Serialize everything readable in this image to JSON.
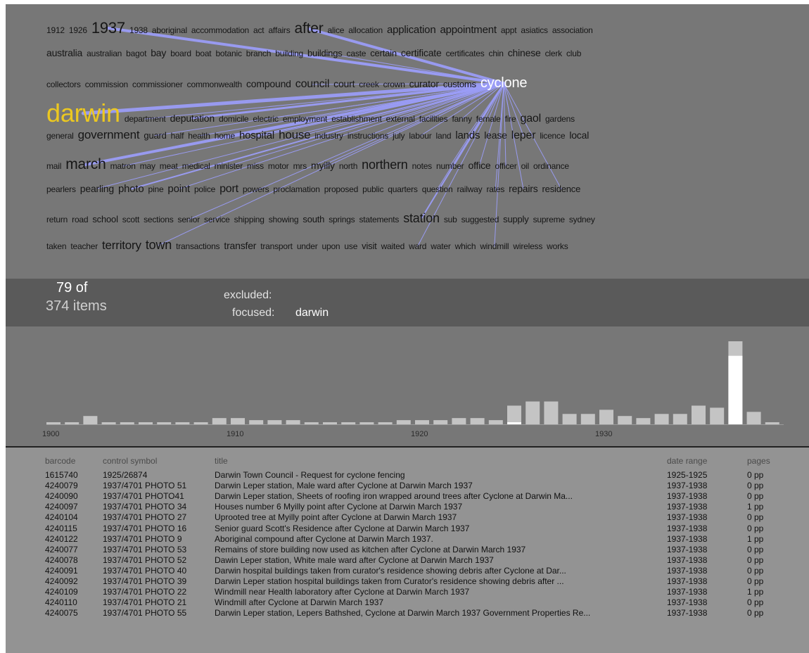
{
  "cloud": {
    "highlight_word": "darwin",
    "focus_word": "cyclone",
    "line_color": "#9a9cf6",
    "highlight_color": "#ecc820",
    "rows": [
      [
        {
          "t": "1912",
          "s": 12
        },
        {
          "t": "1926",
          "s": 12
        },
        {
          "t": "1937",
          "s": 22
        },
        {
          "t": "1938",
          "s": 12
        },
        {
          "t": "aboriginal",
          "s": 12
        },
        {
          "t": "accommodation",
          "s": 12
        },
        {
          "t": "act",
          "s": 12
        },
        {
          "t": "affairs",
          "s": 12
        },
        {
          "t": "after",
          "s": 21
        },
        {
          "t": "alice",
          "s": 12
        },
        {
          "t": "allocation",
          "s": 12
        },
        {
          "t": "application",
          "s": 15
        },
        {
          "t": "appointment",
          "s": 15
        },
        {
          "t": "appt",
          "s": 12
        },
        {
          "t": "asiatics",
          "s": 12
        },
        {
          "t": "association",
          "s": 12
        }
      ],
      [
        {
          "t": "australia",
          "s": 14
        },
        {
          "t": "australian",
          "s": 12
        },
        {
          "t": "bagot",
          "s": 12
        },
        {
          "t": "bay",
          "s": 14
        },
        {
          "t": "board",
          "s": 12
        },
        {
          "t": "boat",
          "s": 12
        },
        {
          "t": "botanic",
          "s": 12
        },
        {
          "t": "branch",
          "s": 12
        },
        {
          "t": "building",
          "s": 12
        },
        {
          "t": "buildings",
          "s": 13
        },
        {
          "t": "caste",
          "s": 12
        },
        {
          "t": "certain",
          "s": 13
        },
        {
          "t": "certificate",
          "s": 14
        },
        {
          "t": "certificates",
          "s": 12
        },
        {
          "t": "chin",
          "s": 12
        },
        {
          "t": "chinese",
          "s": 14
        },
        {
          "t": "clerk",
          "s": 12
        },
        {
          "t": "club",
          "s": 12
        }
      ],
      [
        {
          "t": "collectors",
          "s": 12
        },
        {
          "t": "commission",
          "s": 12
        },
        {
          "t": "commissioner",
          "s": 12
        },
        {
          "t": "commonwealth",
          "s": 12
        },
        {
          "t": "compound",
          "s": 14
        },
        {
          "t": "council",
          "s": 16
        },
        {
          "t": "court",
          "s": 14
        },
        {
          "t": "creek",
          "s": 12
        },
        {
          "t": "crown",
          "s": 12
        },
        {
          "t": "curator",
          "s": 14
        },
        {
          "t": "customs",
          "s": 13
        },
        {
          "t": "cyclone",
          "s": 20
        }
      ],
      [
        {
          "t": "darwin",
          "s": 36
        },
        {
          "t": "department",
          "s": 12
        },
        {
          "t": "deputation",
          "s": 14
        },
        {
          "t": "domicile",
          "s": 12
        },
        {
          "t": "electric",
          "s": 12
        },
        {
          "t": "employment",
          "s": 12
        },
        {
          "t": "establishment",
          "s": 12
        },
        {
          "t": "external",
          "s": 12
        },
        {
          "t": "facilities",
          "s": 12
        },
        {
          "t": "fanny",
          "s": 12
        },
        {
          "t": "female",
          "s": 12
        },
        {
          "t": "fire",
          "s": 12
        },
        {
          "t": "gaol",
          "s": 16
        },
        {
          "t": "gardens",
          "s": 12
        }
      ],
      [
        {
          "t": "general",
          "s": 12
        },
        {
          "t": "government",
          "s": 17
        },
        {
          "t": "guard",
          "s": 13
        },
        {
          "t": "half",
          "s": 12
        },
        {
          "t": "health",
          "s": 12
        },
        {
          "t": "home",
          "s": 12
        },
        {
          "t": "hospital",
          "s": 15
        },
        {
          "t": "house",
          "s": 17
        },
        {
          "t": "industry",
          "s": 12
        },
        {
          "t": "instructions",
          "s": 12
        },
        {
          "t": "july",
          "s": 12
        },
        {
          "t": "labour",
          "s": 12
        },
        {
          "t": "land",
          "s": 12
        },
        {
          "t": "lands",
          "s": 15
        },
        {
          "t": "lease",
          "s": 14
        },
        {
          "t": "leper",
          "s": 16
        },
        {
          "t": "licence",
          "s": 12
        },
        {
          "t": "local",
          "s": 14
        }
      ],
      [
        {
          "t": "mail",
          "s": 12
        },
        {
          "t": "march",
          "s": 21
        },
        {
          "t": "matron",
          "s": 12
        },
        {
          "t": "may",
          "s": 12
        },
        {
          "t": "meat",
          "s": 12
        },
        {
          "t": "medical",
          "s": 12
        },
        {
          "t": "minister",
          "s": 12
        },
        {
          "t": "miss",
          "s": 12
        },
        {
          "t": "motor",
          "s": 12
        },
        {
          "t": "mrs",
          "s": 12
        },
        {
          "t": "myilly",
          "s": 14
        },
        {
          "t": "north",
          "s": 12
        },
        {
          "t": "northern",
          "s": 18
        },
        {
          "t": "notes",
          "s": 12
        },
        {
          "t": "number",
          "s": 12
        },
        {
          "t": "office",
          "s": 14
        },
        {
          "t": "officer",
          "s": 12
        },
        {
          "t": "oil",
          "s": 12
        },
        {
          "t": "ordinance",
          "s": 12
        }
      ],
      [
        {
          "t": "pearlers",
          "s": 12
        },
        {
          "t": "pearling",
          "s": 14
        },
        {
          "t": "photo",
          "s": 15
        },
        {
          "t": "pine",
          "s": 12
        },
        {
          "t": "point",
          "s": 15
        },
        {
          "t": "police",
          "s": 12
        },
        {
          "t": "port",
          "s": 16
        },
        {
          "t": "powers",
          "s": 12
        },
        {
          "t": "proclamation",
          "s": 12
        },
        {
          "t": "proposed",
          "s": 12
        },
        {
          "t": "public",
          "s": 12
        },
        {
          "t": "quarters",
          "s": 12
        },
        {
          "t": "question",
          "s": 12
        },
        {
          "t": "railway",
          "s": 12
        },
        {
          "t": "rates",
          "s": 12
        },
        {
          "t": "repairs",
          "s": 14
        },
        {
          "t": "residence",
          "s": 13
        }
      ],
      [
        {
          "t": "return",
          "s": 12
        },
        {
          "t": "road",
          "s": 12
        },
        {
          "t": "school",
          "s": 13
        },
        {
          "t": "scott",
          "s": 12
        },
        {
          "t": "sections",
          "s": 12
        },
        {
          "t": "senior",
          "s": 12
        },
        {
          "t": "service",
          "s": 12
        },
        {
          "t": "shipping",
          "s": 12
        },
        {
          "t": "showing",
          "s": 12
        },
        {
          "t": "south",
          "s": 13
        },
        {
          "t": "springs",
          "s": 12
        },
        {
          "t": "statements",
          "s": 12
        },
        {
          "t": "station",
          "s": 18
        },
        {
          "t": "sub",
          "s": 12
        },
        {
          "t": "suggested",
          "s": 12
        },
        {
          "t": "supply",
          "s": 13
        },
        {
          "t": "supreme",
          "s": 12
        },
        {
          "t": "sydney",
          "s": 12
        }
      ],
      [
        {
          "t": "taken",
          "s": 12
        },
        {
          "t": "teacher",
          "s": 12
        },
        {
          "t": "territory",
          "s": 17
        },
        {
          "t": "town",
          "s": 18
        },
        {
          "t": "transactions",
          "s": 12
        },
        {
          "t": "transfer",
          "s": 14
        },
        {
          "t": "transport",
          "s": 12
        },
        {
          "t": "under",
          "s": 12
        },
        {
          "t": "upon",
          "s": 12
        },
        {
          "t": "use",
          "s": 12
        },
        {
          "t": "visit",
          "s": 13
        },
        {
          "t": "waited",
          "s": 12
        },
        {
          "t": "ward",
          "s": 12
        },
        {
          "t": "water",
          "s": 12
        },
        {
          "t": "which",
          "s": 12
        },
        {
          "t": "windmill",
          "s": 12
        },
        {
          "t": "wireless",
          "s": 12
        },
        {
          "t": "works",
          "s": 12
        }
      ]
    ],
    "links": [
      {
        "to": "1937",
        "w": 4
      },
      {
        "to": "after",
        "w": 4
      },
      {
        "to": "building",
        "w": 1
      },
      {
        "to": "buildings",
        "w": 1
      },
      {
        "to": "council",
        "w": 1
      },
      {
        "to": "darwin",
        "w": 5
      },
      {
        "to": "department",
        "w": 1
      },
      {
        "to": "deputation",
        "w": 3
      },
      {
        "to": "electric",
        "w": 1
      },
      {
        "to": "employment",
        "w": 1
      },
      {
        "to": "establishment",
        "w": 1
      },
      {
        "to": "external",
        "w": 1
      },
      {
        "to": "facilities",
        "w": 1
      },
      {
        "to": "fanny",
        "w": 1
      },
      {
        "to": "female",
        "w": 1
      },
      {
        "to": "fire",
        "w": 1
      },
      {
        "to": "guard",
        "w": 1
      },
      {
        "to": "health",
        "w": 1
      },
      {
        "to": "home",
        "w": 1
      },
      {
        "to": "hospital",
        "w": 2
      },
      {
        "to": "house",
        "w": 1
      },
      {
        "to": "instructions",
        "w": 1
      },
      {
        "to": "labour",
        "w": 1
      },
      {
        "to": "lands",
        "w": 1
      },
      {
        "to": "leper",
        "w": 1
      },
      {
        "to": "march",
        "w": 4
      },
      {
        "to": "matron",
        "w": 1
      },
      {
        "to": "minister",
        "w": 1
      },
      {
        "to": "myilly",
        "w": 1
      },
      {
        "to": "number",
        "w": 1
      },
      {
        "to": "office",
        "w": 1
      },
      {
        "to": "officer",
        "w": 1
      },
      {
        "to": "pearling",
        "w": 1
      },
      {
        "to": "photo",
        "w": 2
      },
      {
        "to": "point",
        "w": 1
      },
      {
        "to": "question",
        "w": 1
      },
      {
        "to": "rates",
        "w": 1
      },
      {
        "to": "repairs",
        "w": 1
      },
      {
        "to": "residence",
        "w": 1
      },
      {
        "to": "senior",
        "w": 1
      },
      {
        "to": "station",
        "w": 2
      },
      {
        "to": "town",
        "w": 1
      },
      {
        "to": "ward",
        "w": 1
      },
      {
        "to": "windmill",
        "w": 1
      }
    ]
  },
  "status": {
    "count_shown": "79 of",
    "count_total": "374 items",
    "excluded_label": "excluded:",
    "focused_label": "focused:",
    "focused_value": "darwin"
  },
  "histogram": {
    "colors": {
      "total": "#c4c4c4",
      "selected": "#ffffff"
    },
    "year_start": 1900,
    "year_end": 1939,
    "tick_labels": [
      "1900",
      "1910",
      "1920",
      "1930"
    ],
    "totals": [
      1,
      1,
      4,
      1,
      1,
      1,
      1,
      1,
      1,
      3,
      3,
      2,
      2,
      2,
      1,
      1,
      1,
      1,
      1,
      2,
      2,
      2,
      3,
      3,
      2,
      9,
      11,
      11,
      5,
      5,
      7,
      4,
      3,
      5,
      5,
      9,
      8,
      40,
      6,
      1
    ],
    "selected": [
      0,
      0,
      0,
      0,
      0,
      0,
      0,
      0,
      0,
      0,
      0,
      0,
      0,
      0,
      0,
      0,
      0,
      0,
      0,
      0,
      0,
      0,
      0,
      0,
      0,
      1,
      0,
      0,
      0,
      0,
      0,
      0,
      0,
      0,
      0,
      0,
      0,
      33,
      0,
      0
    ],
    "max": 40
  },
  "list": {
    "headers": {
      "barcode": "barcode",
      "control": "control symbol",
      "title": "title",
      "date": "date range",
      "pages": "pages"
    },
    "rows": [
      {
        "barcode": "1615740",
        "control": "1925/26874",
        "title": "Darwin Town Council - Request for cyclone fencing",
        "date": "1925-1925",
        "pages": "0 pp"
      },
      {
        "barcode": "4240079",
        "control": "1937/4701 PHOTO 51",
        "title": "Darwin Leper station, Male ward after Cyclone at Darwin March 1937",
        "date": "1937-1938",
        "pages": "0 pp"
      },
      {
        "barcode": "4240090",
        "control": "1937/4701 PHOTO41",
        "title": "Darwin Leper station, Sheets of roofing iron wrapped around trees after Cyclone at Darwin Ma...",
        "date": "1937-1938",
        "pages": "0 pp"
      },
      {
        "barcode": "4240097",
        "control": "1937/4701 PHOTO 34",
        "title": "Houses number 6 Myilly point after Cyclone at Darwin March 1937",
        "date": "1937-1938",
        "pages": "1 pp"
      },
      {
        "barcode": "4240104",
        "control": "1937/4701 PHOTO 27",
        "title": "Uprooted tree at Myilly point after Cyclone at Darwin March 1937",
        "date": "1937-1938",
        "pages": "0 pp"
      },
      {
        "barcode": "4240115",
        "control": "1937/4701 PHOTO 16",
        "title": "Senior guard Scott's Residence after Cyclone at Darwin March 1937",
        "date": "1937-1938",
        "pages": "0 pp"
      },
      {
        "barcode": "4240122",
        "control": "1937/4701 PHOTO 9",
        "title": "Aboriginal compound after Cyclone at Darwin March 1937.",
        "date": "1937-1938",
        "pages": "1 pp"
      },
      {
        "barcode": "4240077",
        "control": "1937/4701 PHOTO 53",
        "title": "Remains of store building now used as kitchen after Cyclone at Darwin March 1937",
        "date": "1937-1938",
        "pages": "0 pp"
      },
      {
        "barcode": "4240078",
        "control": "1937/4701 PHOTO 52",
        "title": "Dawin Leper station, White male ward after Cyclone at Darwin March 1937",
        "date": "1937-1938",
        "pages": "0 pp"
      },
      {
        "barcode": "4240091",
        "control": "1937/4701 PHOTO 40",
        "title": "Darwin hospital buildings taken from curator's residence showing debris after Cyclone at Dar...",
        "date": "1937-1938",
        "pages": "0 pp"
      },
      {
        "barcode": "4240092",
        "control": "1937/4701 PHOTO 39",
        "title": "Darwin Leper station hospital buildings taken from Curator's residence showing debris after ...",
        "date": "1937-1938",
        "pages": "0 pp"
      },
      {
        "barcode": "4240109",
        "control": "1937/4701 PHOTO 22",
        "title": "Windmill near Health laboratory after Cyclone at Darwin March 1937",
        "date": "1937-1938",
        "pages": "1 pp"
      },
      {
        "barcode": "4240110",
        "control": "1937/4701 PHOTO 21",
        "title": "Windmill after Cyclone at Darwin March 1937",
        "date": "1937-1938",
        "pages": "0 pp"
      },
      {
        "barcode": "4240075",
        "control": "1937/4701 PHOTO 55",
        "title": "Darwin Leper station, Lepers Bathshed, Cyclone at Darwin March 1937 Government Properties Re...",
        "date": "1937-1938",
        "pages": "0 pp"
      }
    ]
  }
}
